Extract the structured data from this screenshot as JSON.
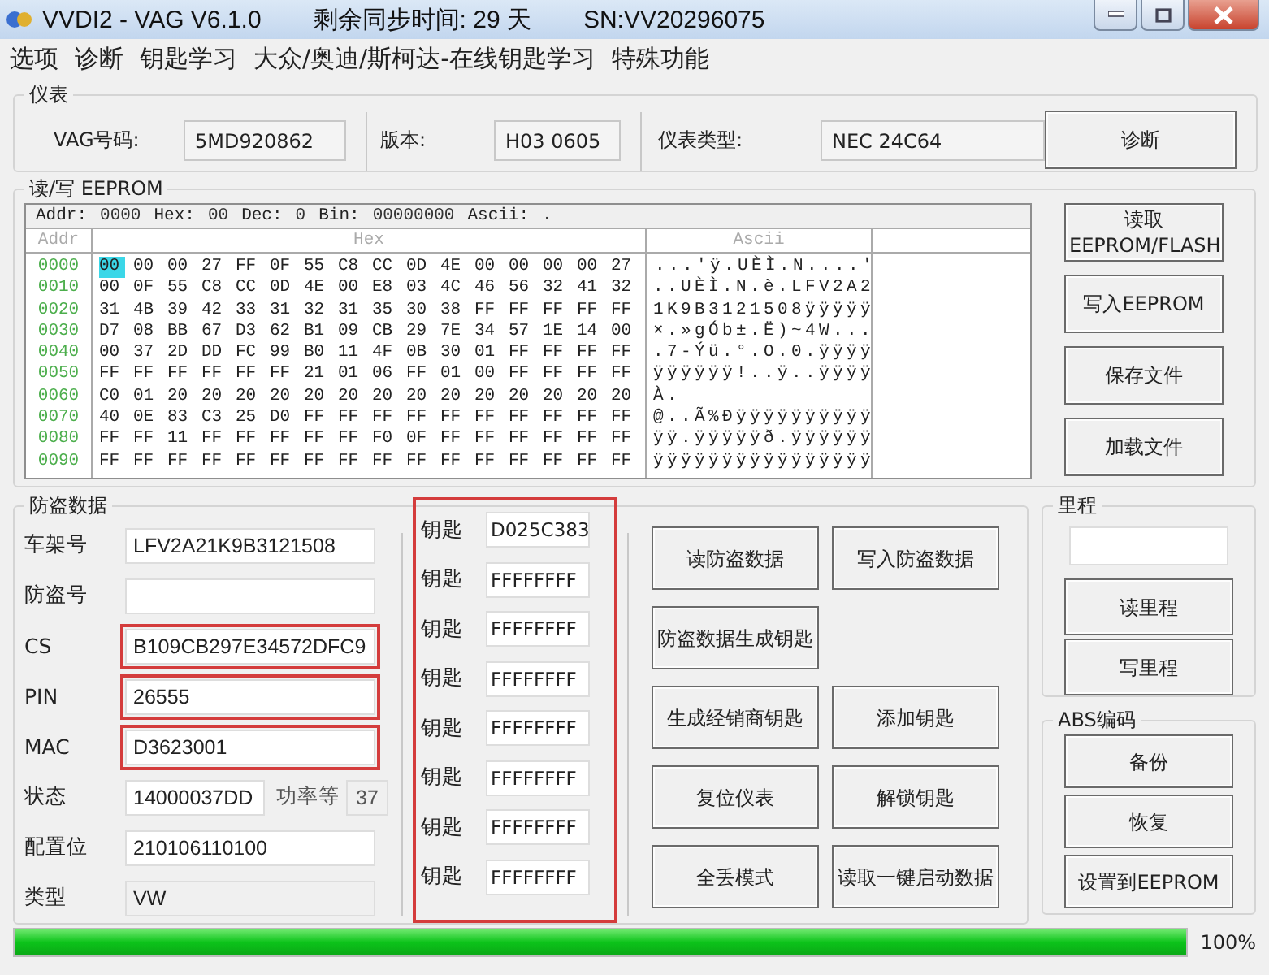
{
  "window": {
    "title": "VVDI2 - VAG V6.1.0",
    "sync_time": "剩余同步时间: 29 天",
    "serial": "SN:VV20296075"
  },
  "menu": [
    "选项",
    "诊断",
    "钥匙学习",
    "大众/奥迪/斯柯达-在线钥匙学习",
    "特殊功能"
  ],
  "cluster": {
    "title": "仪表",
    "fields": [
      {
        "label": "VAG号码:",
        "value": "5MD920862"
      },
      {
        "label": "版本:",
        "value": "H03 0605"
      },
      {
        "label": "仪表类型:",
        "value": "NEC 24C64"
      }
    ],
    "button": "诊断"
  },
  "eeprom": {
    "title": "读/写 EEPROM",
    "info": [
      {
        "label": "Addr:",
        "value": "0000"
      },
      {
        "label": "Hex:",
        "value": "00"
      },
      {
        "label": "Dec:",
        "value": "0"
      },
      {
        "label": "Bin:",
        "value": "00000000"
      },
      {
        "label": "Ascii:",
        "value": "."
      }
    ],
    "headers": [
      "Addr",
      "Hex",
      "Ascii"
    ],
    "rows": [
      {
        "addr": "0000",
        "cursor": true,
        "bytes": [
          "00",
          "00",
          "00",
          "27",
          "FF",
          "0F",
          "55",
          "C8",
          "CC",
          "0D",
          "4E",
          "00",
          "00",
          "00",
          "00",
          "27"
        ],
        "ascii": "...'ÿ.UÈÌ.N....'"
      },
      {
        "addr": "0010",
        "cursor": false,
        "bytes": [
          "00",
          "0F",
          "55",
          "C8",
          "CC",
          "0D",
          "4E",
          "00",
          "E8",
          "03",
          "4C",
          "46",
          "56",
          "32",
          "41",
          "32"
        ],
        "ascii": "..UÈÌ.N.è.LFV2A2"
      },
      {
        "addr": "0020",
        "cursor": false,
        "bytes": [
          "31",
          "4B",
          "39",
          "42",
          "33",
          "31",
          "32",
          "31",
          "35",
          "30",
          "38",
          "FF",
          "FF",
          "FF",
          "FF",
          "FF"
        ],
        "ascii": "1K9B3121508ÿÿÿÿÿ"
      },
      {
        "addr": "0030",
        "cursor": false,
        "bytes": [
          "D7",
          "08",
          "BB",
          "67",
          "D3",
          "62",
          "B1",
          "09",
          "CB",
          "29",
          "7E",
          "34",
          "57",
          "1E",
          "14",
          "00"
        ],
        "ascii": "×.»gÓb±.Ë)~4W..."
      },
      {
        "addr": "0040",
        "cursor": false,
        "bytes": [
          "00",
          "37",
          "2D",
          "DD",
          "FC",
          "99",
          "B0",
          "11",
          "4F",
          "0B",
          "30",
          "01",
          "FF",
          "FF",
          "FF",
          "FF"
        ],
        "ascii": ".7-Ýü.°.O.0.ÿÿÿÿ"
      },
      {
        "addr": "0050",
        "cursor": false,
        "bytes": [
          "FF",
          "FF",
          "FF",
          "FF",
          "FF",
          "FF",
          "21",
          "01",
          "06",
          "FF",
          "01",
          "00",
          "FF",
          "FF",
          "FF",
          "FF"
        ],
        "ascii": "ÿÿÿÿÿÿ!..ÿ..ÿÿÿÿ"
      },
      {
        "addr": "0060",
        "cursor": false,
        "bytes": [
          "C0",
          "01",
          "20",
          "20",
          "20",
          "20",
          "20",
          "20",
          "20",
          "20",
          "20",
          "20",
          "20",
          "20",
          "20",
          "20"
        ],
        "ascii": "À."
      },
      {
        "addr": "0070",
        "cursor": false,
        "bytes": [
          "40",
          "0E",
          "83",
          "C3",
          "25",
          "D0",
          "FF",
          "FF",
          "FF",
          "FF",
          "FF",
          "FF",
          "FF",
          "FF",
          "FF",
          "FF"
        ],
        "ascii": "@..Ã%Ðÿÿÿÿÿÿÿÿÿÿ"
      },
      {
        "addr": "0080",
        "cursor": false,
        "bytes": [
          "FF",
          "FF",
          "11",
          "FF",
          "FF",
          "FF",
          "FF",
          "FF",
          "F0",
          "0F",
          "FF",
          "FF",
          "FF",
          "FF",
          "FF",
          "FF"
        ],
        "ascii": "ÿÿ.ÿÿÿÿÿð.ÿÿÿÿÿÿ"
      },
      {
        "addr": "0090",
        "cursor": false,
        "bytes": [
          "FF",
          "FF",
          "FF",
          "FF",
          "FF",
          "FF",
          "FF",
          "FF",
          "FF",
          "FF",
          "FF",
          "FF",
          "FF",
          "FF",
          "FF",
          "FF"
        ],
        "ascii": "ÿÿÿÿÿÿÿÿÿÿÿÿÿÿÿÿ"
      }
    ],
    "buttons": [
      "读取\nEEPROM/FLASH",
      "写入EEPROM",
      "保存文件",
      "加载文件"
    ]
  },
  "immo": {
    "title": "防盗数据",
    "fields": [
      {
        "label": "车架号",
        "value": "LFV2A21K9B3121508",
        "highlighted": false,
        "readonly": false
      },
      {
        "label": "防盗号",
        "highlighted": false,
        "readonly": false
      },
      {
        "label": "CS",
        "value": "B109CB297E34572DFC9",
        "highlighted": true,
        "readonly": false
      },
      {
        "label": "PIN",
        "value": "26555",
        "highlighted": true,
        "readonly": false
      },
      {
        "label": "MAC",
        "value": "D3623001",
        "highlighted": true,
        "readonly": false
      },
      {
        "label": "状态",
        "value": "14000037DD",
        "highlighted": false,
        "readonly": false,
        "extra": {
          "label": "功率等",
          "value": "37"
        }
      },
      {
        "label": "配置位",
        "value": "210106110100",
        "highlighted": false,
        "readonly": false
      },
      {
        "label": "类型",
        "value": "VW",
        "highlighted": false,
        "readonly": true
      }
    ],
    "keys_highlighted": true,
    "keys": [
      {
        "label": "钥匙",
        "value": "D025C383"
      },
      {
        "label": "钥匙",
        "value": "FFFFFFFF"
      },
      {
        "label": "钥匙",
        "value": "FFFFFFFF"
      },
      {
        "label": "钥匙",
        "value": "FFFFFFFF"
      },
      {
        "label": "钥匙",
        "value": "FFFFFFFF"
      },
      {
        "label": "钥匙",
        "value": "FFFFFFFF"
      },
      {
        "label": "钥匙",
        "value": "FFFFFFFF"
      },
      {
        "label": "钥匙",
        "value": "FFFFFFFF"
      }
    ],
    "button_rows": [
      [
        "读防盗数据",
        "写入防盗数据"
      ],
      [
        "防盗数据生成钥匙"
      ],
      [
        "生成经销商钥匙",
        "添加钥匙"
      ],
      [
        "复位仪表",
        "解锁钥匙"
      ],
      [
        "全丢模式",
        "读取一键启动数据"
      ]
    ]
  },
  "mileage": {
    "title": "里程",
    "buttons": [
      "读里程",
      "写里程"
    ]
  },
  "abs": {
    "title": "ABS编码",
    "buttons": [
      "备份",
      "恢复",
      "设置到EEPROM"
    ]
  },
  "progress": {
    "level": 1,
    "reading": "100%"
  }
}
